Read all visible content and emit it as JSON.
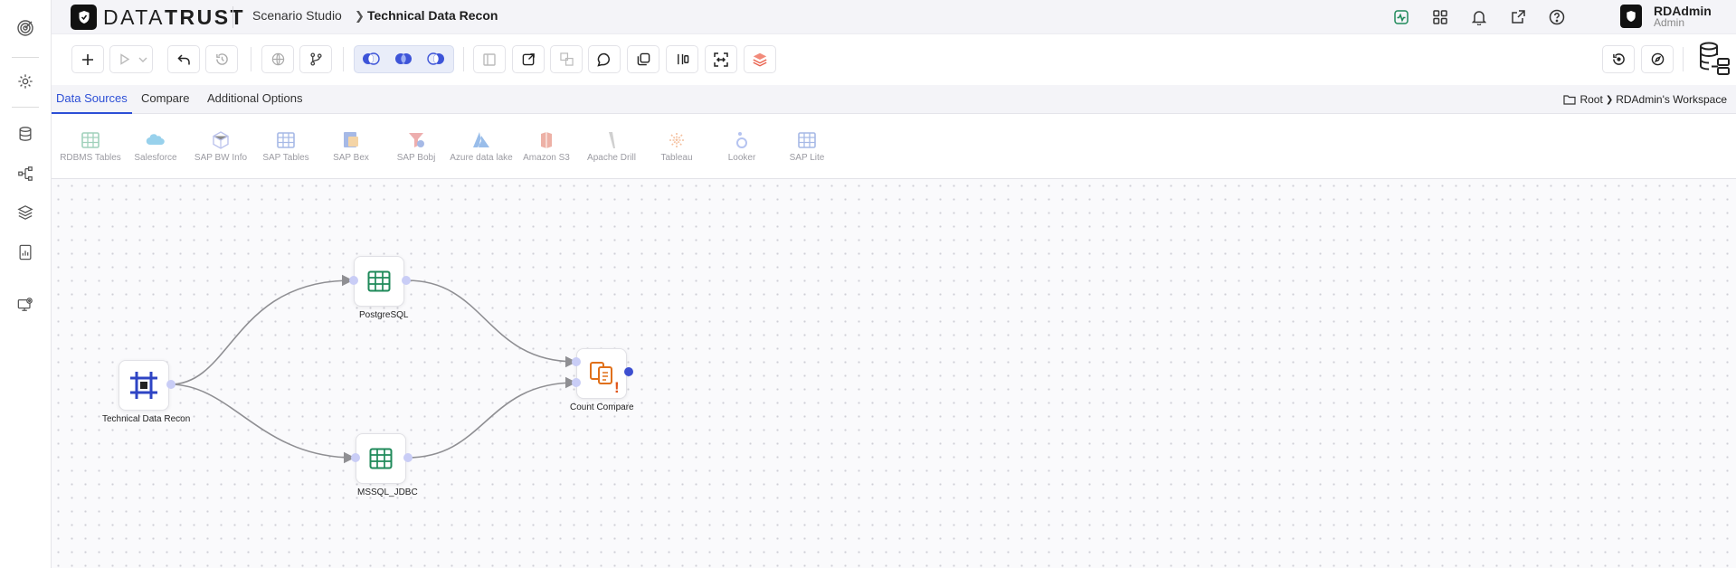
{
  "app": {
    "logo_text_a": "DATA",
    "logo_text_b": "TRUST",
    "breadcrumb": {
      "section": "Scenario Studio",
      "current": "Technical Data Recon"
    },
    "user": {
      "name": "RDAdmin",
      "role": "Admin"
    }
  },
  "rail_icons": [
    "target-icon",
    "settings-icon",
    "database-icon",
    "network-icon",
    "layers-icon",
    "report-icon",
    "monitor-settings-icon"
  ],
  "header_icons": [
    "activity-icon",
    "apps-grid-icon",
    "bell-icon",
    "external-link-icon",
    "help-icon"
  ],
  "toolbar": {
    "buttons": [
      "add",
      "run",
      "run-options",
      "undo",
      "history",
      "globe",
      "branch",
      "join-left",
      "join-inner",
      "join-right",
      "panel",
      "export",
      "transfer",
      "comment",
      "copy",
      "split",
      "fit-screen",
      "layers"
    ],
    "right_buttons": [
      "restore",
      "compass"
    ]
  },
  "tabs": [
    {
      "label": "Data Sources",
      "active": true
    },
    {
      "label": "Compare",
      "active": false
    },
    {
      "label": "Additional Options",
      "active": false
    }
  ],
  "workspace": {
    "root": "Root",
    "name": "RDAdmin's Workspace"
  },
  "sources": [
    {
      "label": "RDBMS Tables",
      "icon": "table-icon"
    },
    {
      "label": "Salesforce",
      "icon": "salesforce-icon"
    },
    {
      "label": "SAP BW Info",
      "icon": "cube-icon"
    },
    {
      "label": "SAP Tables",
      "icon": "table-icon"
    },
    {
      "label": "SAP Bex",
      "icon": "sap-bex-icon"
    },
    {
      "label": "SAP Bobj",
      "icon": "sap-bobj-icon"
    },
    {
      "label": "Azure data lake",
      "icon": "azure-icon"
    },
    {
      "label": "Amazon S3",
      "icon": "s3-icon"
    },
    {
      "label": "Apache Drill",
      "icon": "drill-icon"
    },
    {
      "label": "Tableau",
      "icon": "tableau-icon"
    },
    {
      "label": "Looker",
      "icon": "looker-icon"
    },
    {
      "label": "SAP Lite",
      "icon": "table-icon"
    }
  ],
  "nodes": {
    "source": {
      "label": "Technical Data Recon",
      "icon": "scenario-icon"
    },
    "postgres": {
      "label": "PostgreSQL",
      "icon": "table-icon"
    },
    "mssql": {
      "label": "MSSQL_JDBC",
      "icon": "table-icon"
    },
    "compare": {
      "label": "Count Compare",
      "icon": "count-compare-icon",
      "warning": "!"
    }
  },
  "colors": {
    "accent": "#2d4fd6",
    "node_green": "#1f8a5a",
    "compare_orange": "#e0701a",
    "edge": "#8f8f93"
  }
}
